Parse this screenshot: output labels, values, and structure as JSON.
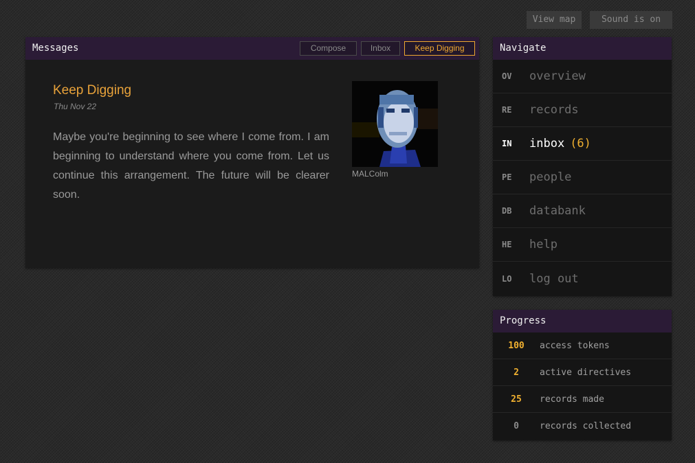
{
  "top_buttons": {
    "view_map": "View map",
    "sound": "Sound is on"
  },
  "messages": {
    "title": "Messages",
    "tabs": [
      {
        "label": "Compose",
        "active": false
      },
      {
        "label": "Inbox",
        "active": false
      },
      {
        "label": "Keep Digging",
        "active": true
      }
    ],
    "message": {
      "subject": "Keep Digging",
      "date": "Thu Nov 22",
      "body": "Maybe you're beginning to see where I come from. I am beginning to understand where you come from. Let us continue this arrangement. The future will be clearer soon.",
      "sender": "MALColm"
    }
  },
  "navigate": {
    "title": "Navigate",
    "items": [
      {
        "code": "OV",
        "label": "overview"
      },
      {
        "code": "RE",
        "label": "records"
      },
      {
        "code": "IN",
        "label": "inbox",
        "count": "(6)",
        "active": true
      },
      {
        "code": "PE",
        "label": "people"
      },
      {
        "code": "DB",
        "label": "databank"
      },
      {
        "code": "HE",
        "label": "help"
      },
      {
        "code": "LO",
        "label": "log out"
      }
    ]
  },
  "progress": {
    "title": "Progress",
    "items": [
      {
        "value": "100",
        "label": "access tokens"
      },
      {
        "value": "2",
        "label": "active directives"
      },
      {
        "value": "25",
        "label": "records made"
      },
      {
        "value": "0",
        "label": "records collected"
      }
    ]
  },
  "colors": {
    "accent": "#f0a830",
    "header": "#2b1b36",
    "panel": "#1b1b1b"
  }
}
